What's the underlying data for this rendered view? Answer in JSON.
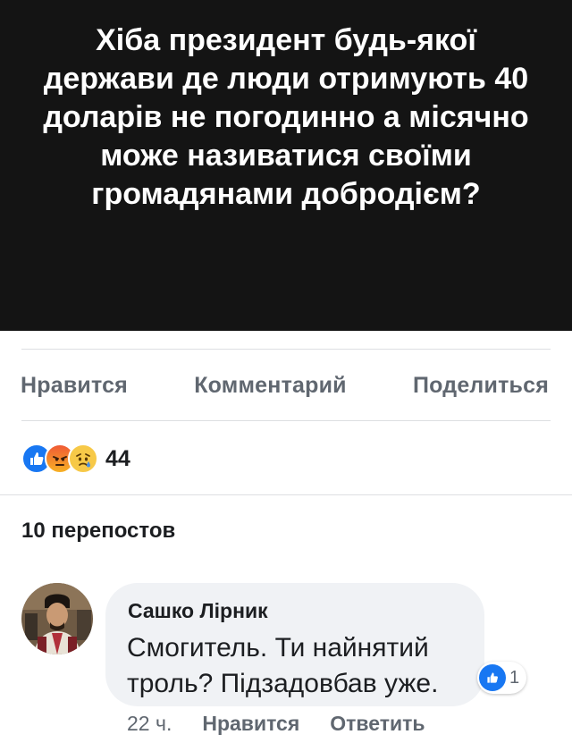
{
  "post": {
    "image_text": "Хіба президент будь-якої держави де люди отримують 40 доларів не погодинно а місячно може називатися своїми громадянами добродієм?"
  },
  "actions": {
    "like": "Нравится",
    "comment": "Комментарий",
    "share": "Поделиться"
  },
  "reactions": {
    "icons": [
      "like-icon",
      "angry-icon",
      "sad-icon"
    ],
    "count": "44"
  },
  "shares": {
    "label": "10 перепостов"
  },
  "comment": {
    "author": "Сашко Лірник",
    "text": "Смогитель. Ти найнятий троль? Підзадовбав уже.",
    "reaction_count": "1",
    "time": "22 ч.",
    "like_label": "Нравится",
    "reply_label": "Ответить"
  },
  "colors": {
    "image_bg": "#141414",
    "accent_blue": "#1877f2",
    "muted_text": "#606770",
    "bubble_bg": "#f0f2f5"
  }
}
